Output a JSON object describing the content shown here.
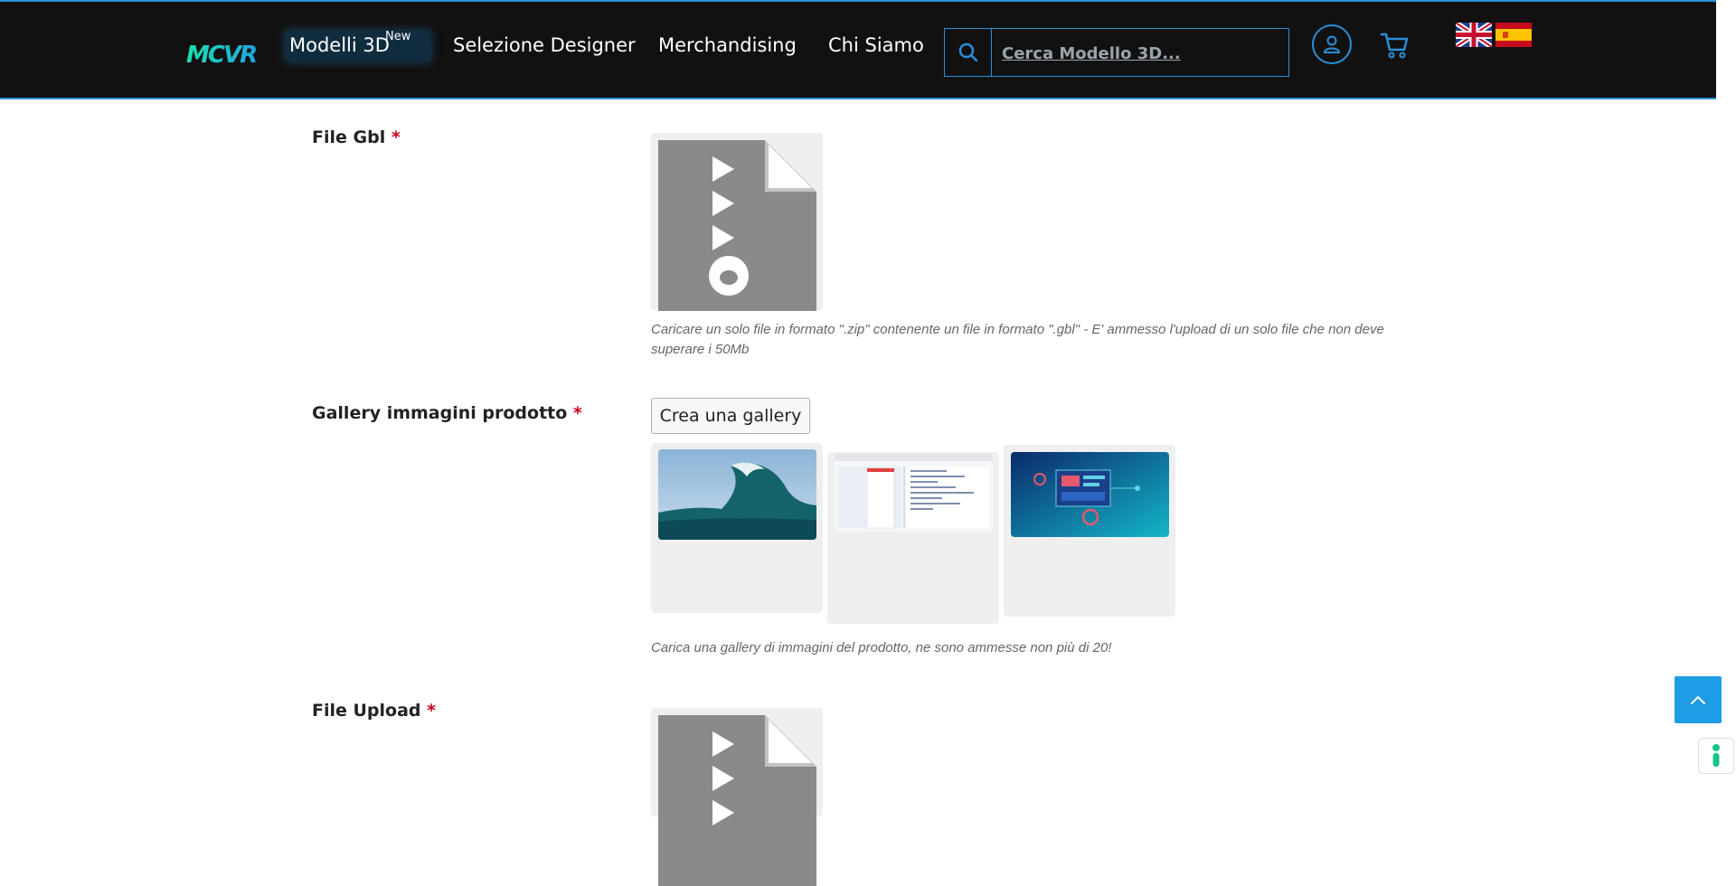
{
  "header": {
    "logo_text": "MCVR",
    "nav": [
      {
        "label": "Modelli 3D",
        "badge": "New"
      },
      {
        "label": "Selezione Designer"
      },
      {
        "label": "Merchandising"
      },
      {
        "label": "Chi Siamo"
      }
    ],
    "search": {
      "placeholder": "Cerca Modello 3D..."
    },
    "icons": [
      "search-icon",
      "user-icon",
      "cart-icon",
      "flag-uk-icon",
      "flag-es-icon"
    ],
    "accent_color": "#2a8fd8"
  },
  "form": {
    "required_mark": "*",
    "file_gbl": {
      "label": "File Gbl",
      "help": "Caricare un solo file in formato \".zip\" contenente un file in formato \".gbl\" - E' ammesso l'upload di un solo file che non deve superare i 50Mb"
    },
    "gallery": {
      "label": "Gallery immagini prodotto",
      "button": "Crea una gallery",
      "help": "Carica una gallery di immagini del prodotto, ne sono ammesse non più di 20!",
      "thumbnails": [
        "wave-image",
        "screenshot-image",
        "tech-illustration-image"
      ]
    },
    "file_upload": {
      "label": "File Upload"
    }
  },
  "colors": {
    "header_bg": "#111111",
    "required": "#d0021b",
    "scroll_button": "#1e9de6"
  }
}
